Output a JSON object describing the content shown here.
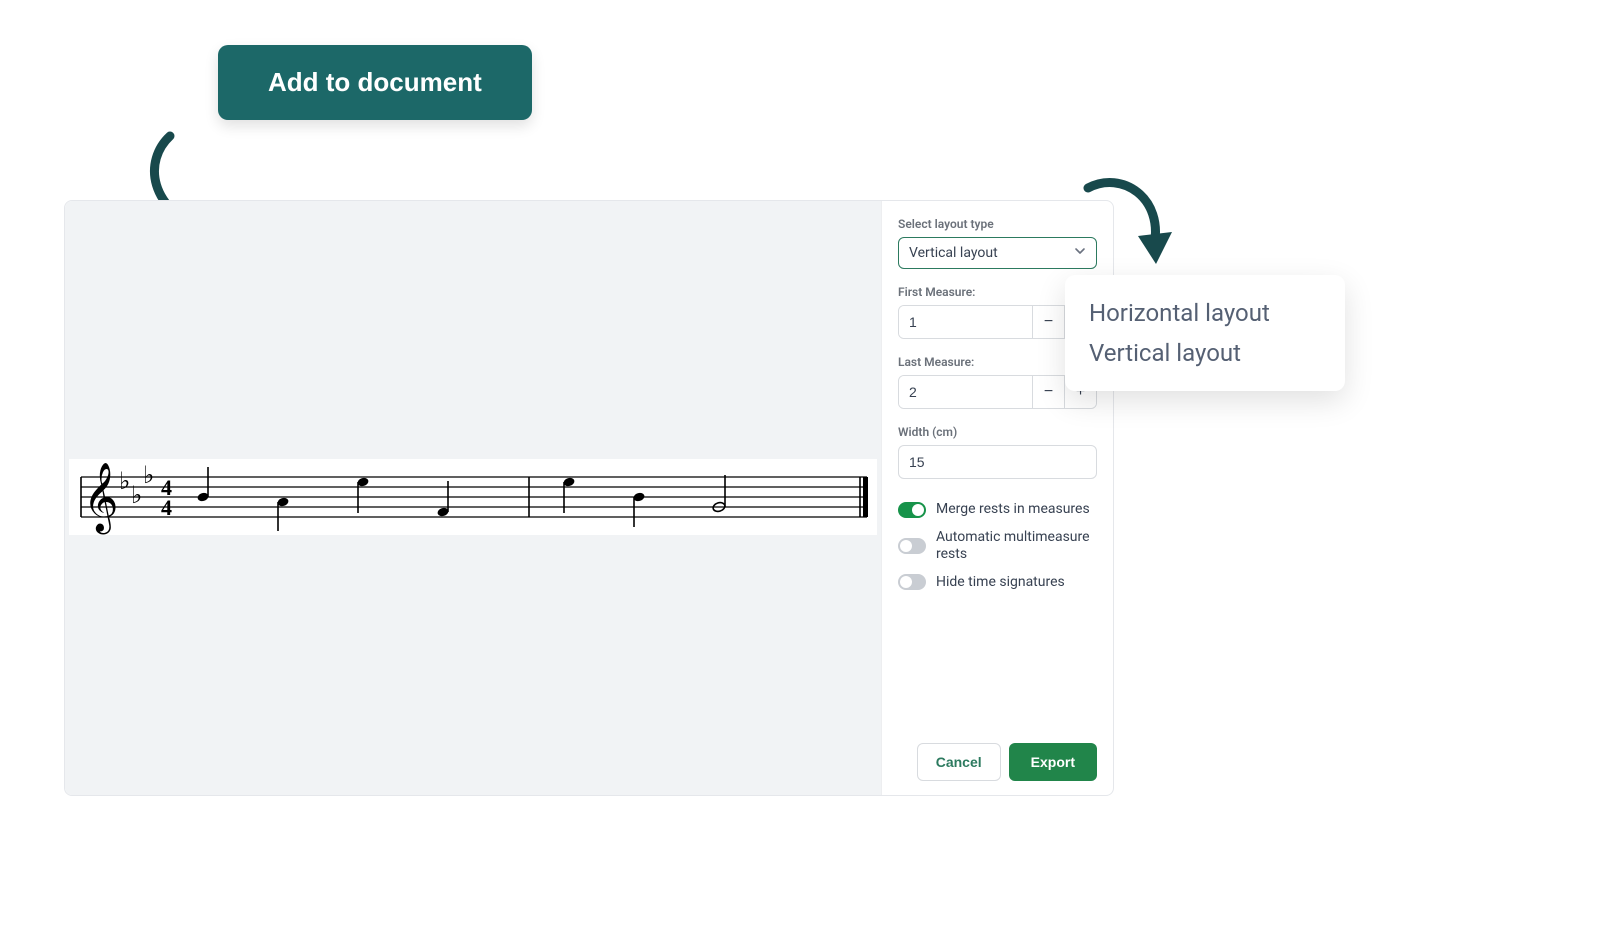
{
  "header": {
    "add_button_label": "Add to document"
  },
  "panel": {
    "select_layout_label": "Select layout type",
    "select_layout_value": "Vertical layout",
    "first_measure_label": "First Measure:",
    "first_measure_value": "1",
    "last_measure_label": "Last Measure:",
    "last_measure_value": "2",
    "width_label": "Width (cm)",
    "width_value": "15",
    "toggle_merge_label": "Merge rests in measures",
    "toggle_automulti_label": "Automatic multimeasure rests",
    "toggle_hide_ts_label": "Hide time signatures",
    "cancel_label": "Cancel",
    "export_label": "Export",
    "stepper_minus": "−",
    "stepper_plus": "+"
  },
  "dropdown": {
    "options": [
      "Horizontal layout",
      "Vertical layout"
    ]
  },
  "colors": {
    "teal_dark": "#1c6868",
    "green_accent": "#21854a",
    "toggle_on": "#17934a"
  }
}
